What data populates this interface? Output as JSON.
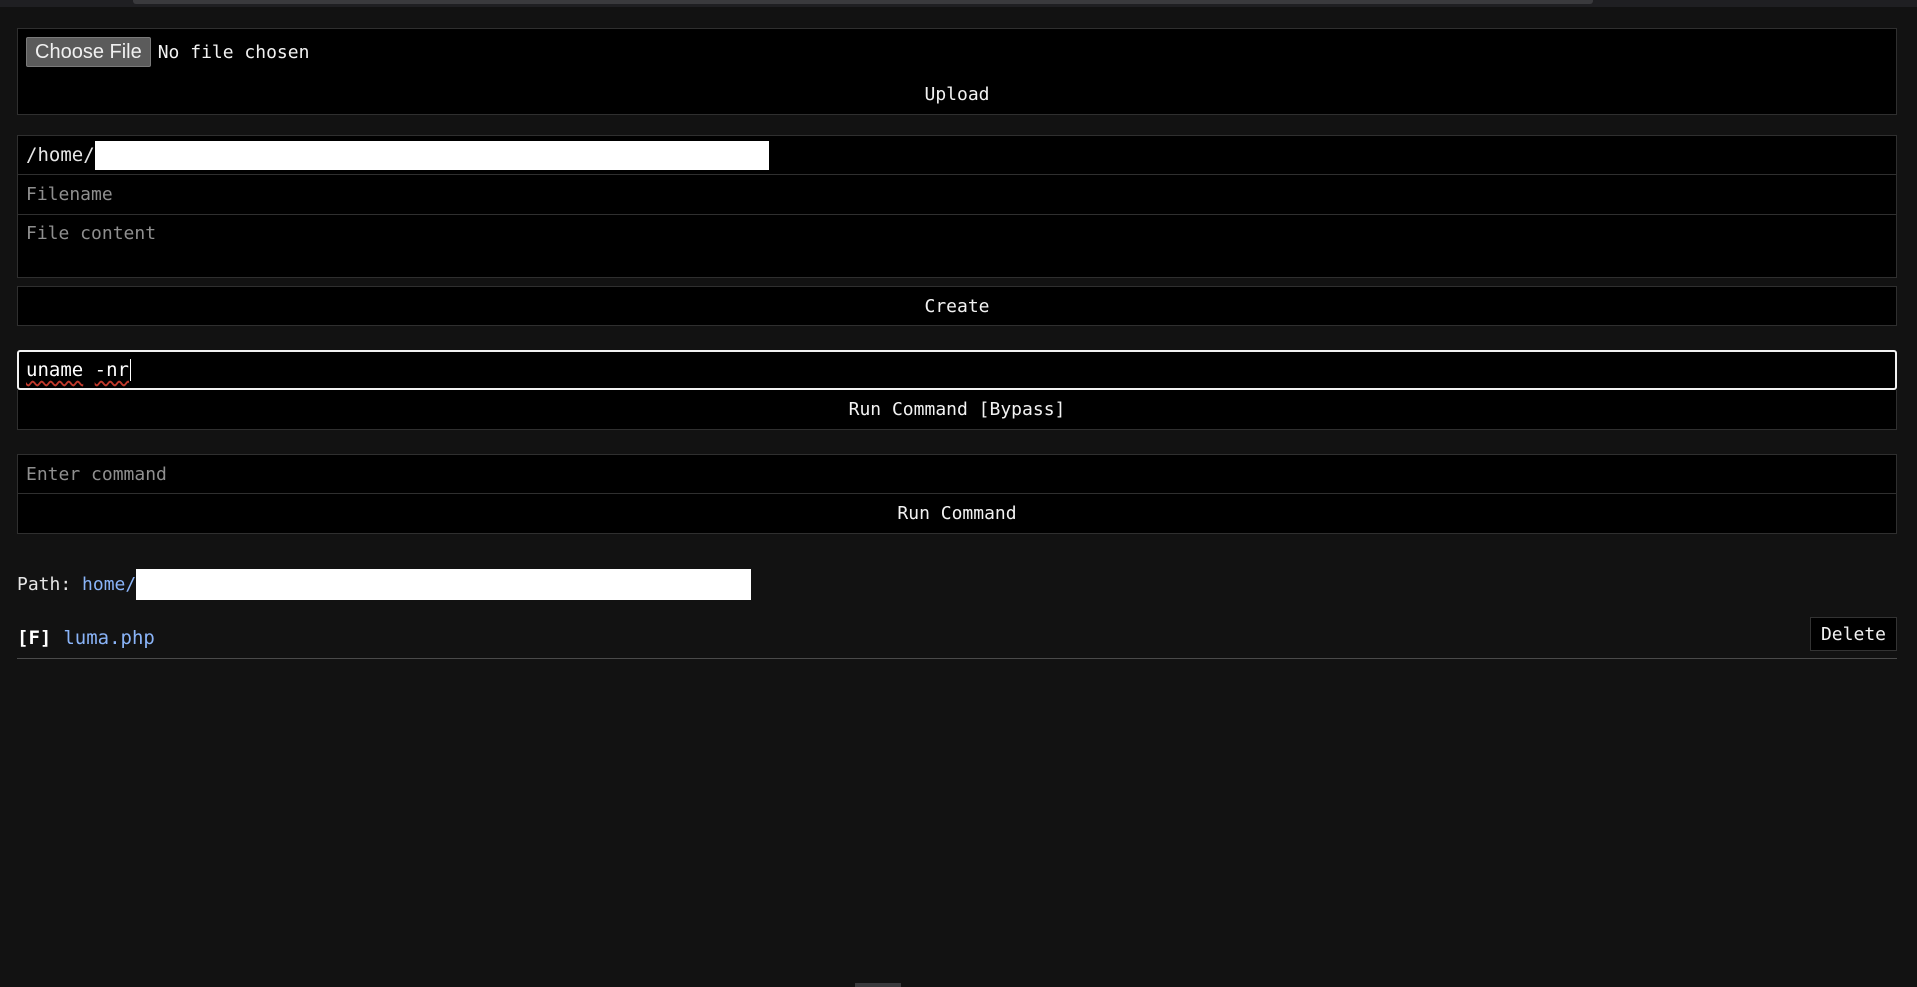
{
  "upload": {
    "choose_label": "Choose File",
    "file_status": "No file chosen",
    "upload_label": "Upload"
  },
  "create": {
    "path_prefix": "/home/",
    "filename_placeholder": "Filename",
    "content_placeholder": "File content",
    "create_label": "Create"
  },
  "bypass": {
    "command_value": "uname -nr",
    "command_word": "uname",
    "command_flag": "-nr",
    "run_label": "Run Command [Bypass]"
  },
  "command": {
    "placeholder": "Enter command",
    "run_label": "Run Command"
  },
  "path": {
    "label": "Path:",
    "segment": "home/"
  },
  "files": [
    {
      "type": "[F]",
      "name": "luma.php",
      "action": "Delete"
    }
  ],
  "colors": {
    "background": "#121212",
    "input_bg": "#000000",
    "link": "#8ab4f8",
    "redaction": "#ffffff"
  }
}
